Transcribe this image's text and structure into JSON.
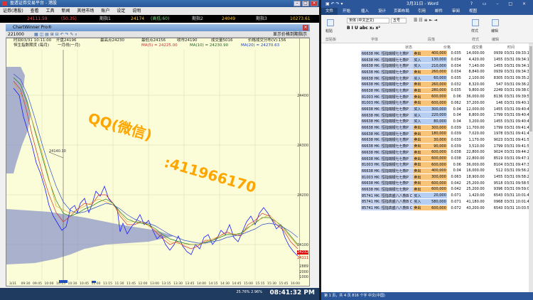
{
  "left_window": {
    "title": "盈透证券交易平台 - 港股",
    "menu": [
      "证券(港股)",
      "查看",
      "工具",
      "新闻",
      "其他市场",
      "账户",
      "设定",
      "说明"
    ],
    "ticker": [
      {
        "label": "24111.59"
      },
      {
        "label": "(50.35)"
      },
      {
        "label": "期指1"
      },
      {
        "label": "24174"
      },
      {
        "label": "(高低:60)"
      },
      {
        "label": "期指2"
      },
      {
        "label": "24049"
      },
      {
        "label": "期指3"
      },
      {
        "label": "10273.61"
      }
    ],
    "chart_window_title": "ChartWinner Pro®",
    "toolbar": {
      "code": "221000",
      "right_btn": "显示价格到期指示"
    },
    "info_line1": [
      "时间03/31 10:11:00",
      "开盘24196",
      "最高点24230",
      "最低点24156",
      "收市24190",
      "成交量5016",
      "价格成交分布(V):156"
    ],
    "info_line2": [
      "恒生指数期货 (每月)",
      "一月线(一月)",
      "MA(5) = 24225.00",
      "MA(10) = 24230.90",
      "MA(20) = 24270.63"
    ],
    "y_labels": [
      "24400",
      "24300",
      "24200",
      "24100",
      "24000"
    ],
    "x_labels": [
      "3/31",
      "09:30",
      "09:45",
      "10:00",
      "10:15",
      "10:30",
      "10:45",
      "11:00",
      "11:15",
      "11:30",
      "11:45",
      "12:00",
      "13:00",
      "13:15",
      "13:30",
      "13:45",
      "14:00",
      "14:15",
      "14:30",
      "14:45",
      "15:00",
      "15:15",
      "15:30",
      "15:45",
      "16:00"
    ],
    "price_tags": [
      "24232",
      "24111"
    ],
    "vol_labels": [
      "2889",
      "2000",
      "1000"
    ],
    "crosshair_label": "24140.10",
    "watermark_1": "QQ(微信)",
    "watermark_2": ":411966170",
    "clock": "08:41:32 PM",
    "tray": {
      "a": "25.76%",
      "b": "2.96%"
    }
  },
  "word": {
    "title": "3月31日 - Word",
    "tabs": [
      "文件",
      "开始",
      "插入",
      "设计",
      "页面布局",
      "引用",
      "邮件",
      "审阅",
      "视图"
    ],
    "font_name": "宋体 (中文正文)",
    "font_size": "五号",
    "ribbon_groups": [
      "剪贴板",
      "字体",
      "段落",
      "样式",
      "编辑"
    ],
    "big_buttons": [
      "粘贴",
      "样式",
      "编辑"
    ],
    "status": "第 1 页，共 4 页    816 个字    中文(中国)",
    "columns": [
      "状态",
      "价格",
      "成交量",
      "时间"
    ],
    "rows": [
      {
        "code": "66638 HK: 恒指瑞银七七熊P",
        "side": "卖出",
        "qty": "400,000",
        "price": "0.035",
        "amt": "14,000.00",
        "n": "0939",
        "t": "03/31 09:33:17",
        "ask": true
      },
      {
        "code": "66638 HK: 恒指瑞银七七熊P",
        "side": "买入",
        "qty": "130,000",
        "price": "0.034",
        "amt": "4,420.00",
        "n": "1455",
        "t": "03/31 09:34:10",
        "ask": false
      },
      {
        "code": "66638 HK: 恒指瑞银七七熊P",
        "side": "买入",
        "qty": "210,000",
        "price": "0.034",
        "amt": "7,140.00",
        "n": "1455",
        "t": "03/31 09:34:10",
        "ask": false
      },
      {
        "code": "66638 HK: 恒指瑞银七七熊P",
        "side": "卖出",
        "qty": "260,000",
        "price": "0.034",
        "amt": "8,840.00",
        "n": "0939",
        "t": "03/31 09:34:37",
        "ask": true
      },
      {
        "code": "66638 HK: 恒指瑞银七七熊P",
        "side": "买入",
        "qty": "60,000",
        "price": "0.035",
        "amt": "2,100.00",
        "n": "8305",
        "t": "03/31 09:35:20",
        "ask": false
      },
      {
        "code": "66638 HK: 恒指瑞银七七熊P",
        "side": "卖出",
        "qty": "260,000",
        "price": "0.032",
        "amt": "8,320.00",
        "n": "547",
        "t": "03/31 09:36:20",
        "ask": true
      },
      {
        "code": "66638 HK: 恒指瑞银七七熊P",
        "side": "卖出",
        "qty": "280,000",
        "price": "0.035",
        "amt": "9,800.00",
        "n": "2249",
        "t": "03/31 09:38:04",
        "ask": true
      },
      {
        "code": "81003 HK: 恒指瑞银七七熊P",
        "side": "卖出",
        "qty": "600,000",
        "price": "0.06",
        "amt": "36,000.00",
        "n": "8136",
        "t": "03/31 09:39:51",
        "ask": true
      },
      {
        "code": "81003 HK: 恒指瑞银七七熊P",
        "side": "卖出",
        "qty": "600,000",
        "price": "0.062",
        "amt": "37,200.00",
        "n": "146",
        "t": "03/31 09:40:12",
        "ask": true
      },
      {
        "code": "66638 HK: 恒指瑞银七七熊P",
        "side": "买入",
        "qty": "300,000",
        "price": "0.04",
        "amt": "12,000.00",
        "n": "1455",
        "t": "03/31 09:40:40",
        "ask": false
      },
      {
        "code": "66638 HK: 恒指瑞银七七熊P",
        "side": "买入",
        "qty": "220,000",
        "price": "0.04",
        "amt": "8,800.00",
        "n": "1799",
        "t": "03/31 09:40:40",
        "ask": false
      },
      {
        "code": "66638 HK: 恒指瑞银七七熊P",
        "side": "买入",
        "qty": "80,000",
        "price": "0.04",
        "amt": "3,200.00",
        "n": "1455",
        "t": "03/31 09:40:40",
        "ask": false
      },
      {
        "code": "66638 HK: 恒指瑞银七七熊P",
        "side": "卖出",
        "qty": "300,000",
        "price": "0.039",
        "amt": "11,700.00",
        "n": "1799",
        "t": "03/31 09:41:44",
        "ask": true
      },
      {
        "code": "66638 HK: 恒指瑞银七七熊P",
        "side": "卖出",
        "qty": "180,000",
        "price": "0.039",
        "amt": "7,020.00",
        "n": "1978",
        "t": "03/31 09:41:49",
        "ask": true
      },
      {
        "code": "66638 HK: 恒指瑞银七七熊P",
        "side": "卖出",
        "qty": "30,000",
        "price": "0.039",
        "amt": "1,170.00",
        "n": "9023",
        "t": "03/31 09:41:58",
        "ask": true
      },
      {
        "code": "66638 HK: 恒指瑞银七七熊P",
        "side": "卖出",
        "qty": "90,000",
        "price": "0.039",
        "amt": "3,510.00",
        "n": "1799",
        "t": "03/31 09:41:58",
        "ask": true
      },
      {
        "code": "66638 HK: 恒指瑞银七七熊P",
        "side": "卖出",
        "qty": "600,000",
        "price": "0.038",
        "amt": "22,800.00",
        "n": "9024",
        "t": "03/31 09:44:22",
        "ask": true
      },
      {
        "code": "66638 HK: 恒指瑞银七七熊P",
        "side": "卖出",
        "qty": "600,000",
        "price": "0.038",
        "amt": "22,800.00",
        "n": "8519",
        "t": "03/31 09:47:17",
        "ask": true
      },
      {
        "code": "81003 HK: 恒指瑞银七七熊P",
        "side": "卖出",
        "qty": "600,000",
        "price": "0.06",
        "amt": "36,000.00",
        "n": "8104",
        "t": "03/31 09:47:37",
        "ask": true
      },
      {
        "code": "66638 HK: 恒指瑞银七七熊P",
        "side": "卖出",
        "qty": "400,000",
        "price": "0.04",
        "amt": "16,000.00",
        "n": "512",
        "t": "03/31 09:56:25",
        "ask": true
      },
      {
        "code": "81003 HK: 恒指瑞银七七熊P",
        "side": "卖出",
        "qty": "300,000",
        "price": "0.063",
        "amt": "18,900.00",
        "n": "1455",
        "t": "03/31 09:58:28",
        "ask": true
      },
      {
        "code": "66638 HK: 恒指瑞银七七熊P",
        "side": "卖出",
        "qty": "600,000",
        "price": "0.042",
        "amt": "25,200.00",
        "n": "9518",
        "t": "03/31 09:58:58",
        "ask": true
      },
      {
        "code": "66638 HK: 恒指瑞银七七熊P",
        "side": "卖出",
        "qty": "600,000",
        "price": "0.042",
        "amt": "25,200.00",
        "n": "9396",
        "t": "03/31 09:59:09",
        "ask": true
      },
      {
        "code": "85741 HK: 恒指高盛八八熊B C",
        "side": "买入",
        "qty": "20,000",
        "price": "0.071",
        "amt": "1,420.00",
        "n": "6543",
        "t": "03/31 10:01:45",
        "ask": false
      },
      {
        "code": "85741 HK: 恒指高盛八八熊B C",
        "side": "买入",
        "qty": "580,000",
        "price": "0.071",
        "amt": "41,180.00",
        "n": "0968",
        "t": "03/31 10:01:47",
        "ask": false
      },
      {
        "code": "85741 HK: 恒指高盛八八熊B C",
        "side": "卖出",
        "qty": "600,000",
        "price": "0.072",
        "amt": "43,200.00",
        "n": "6543",
        "t": "03/31 10:03:59",
        "ask": true
      }
    ]
  }
}
